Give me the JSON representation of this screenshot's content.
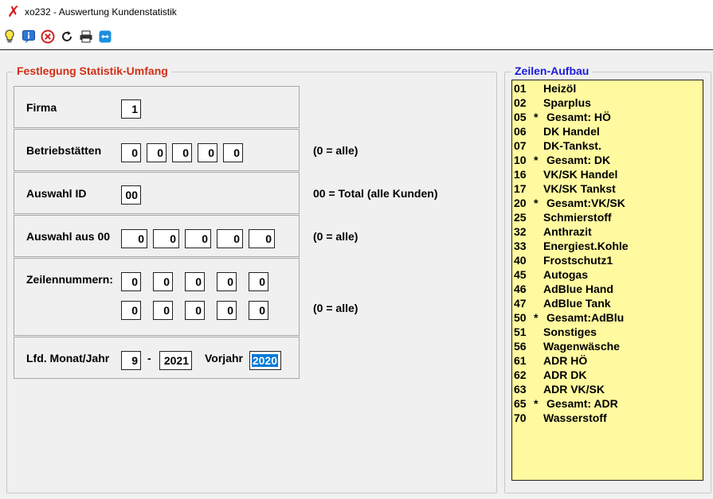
{
  "window": {
    "title": "xo232 - Auswertung Kundenstatistik",
    "icon": "x-icon"
  },
  "toolbar": [
    {
      "name": "lightbulb-icon"
    },
    {
      "name": "info-icon"
    },
    {
      "name": "cancel-icon"
    },
    {
      "name": "refresh-icon"
    },
    {
      "name": "printer-icon"
    },
    {
      "name": "remote-support-icon"
    }
  ],
  "statistik": {
    "legend": "Festlegung Statistik-Umfang",
    "firma": {
      "label": "Firma",
      "value": "1"
    },
    "betriebsstaetten": {
      "label": "Betriebstätten",
      "values": [
        "0",
        "0",
        "0",
        "0",
        "0"
      ],
      "hint": "(0 = alle)"
    },
    "auswahl_id": {
      "label": "Auswahl ID",
      "value": "00",
      "hint": "00 = Total (alle Kunden)"
    },
    "auswahl_aus": {
      "label": "Auswahl aus  00",
      "values": [
        "0",
        "0",
        "0",
        "0",
        "0"
      ],
      "hint": "(0 = alle)"
    },
    "zeilennummern": {
      "label": "Zeilennummern:",
      "row1": [
        "0",
        "0",
        "0",
        "0",
        "0"
      ],
      "row2": [
        "0",
        "0",
        "0",
        "0",
        "0"
      ],
      "hint": "(0 = alle)"
    },
    "monat": {
      "label": "Lfd. Monat/Jahr",
      "month": "9",
      "sep": "-",
      "year": "2021",
      "vorjahr_label": "Vorjahr",
      "vorjahr": "2020"
    }
  },
  "zeilen": {
    "legend": "Zeilen-Aufbau",
    "items": [
      {
        "code": "01",
        "star": "",
        "name": "Heizöl"
      },
      {
        "code": "02",
        "star": "",
        "name": "Sparplus"
      },
      {
        "code": "05",
        "star": "*",
        "name": "Gesamt: HÖ"
      },
      {
        "code": "06",
        "star": "",
        "name": "DK Handel"
      },
      {
        "code": "07",
        "star": "",
        "name": "DK-Tankst."
      },
      {
        "code": "10",
        "star": "*",
        "name": "Gesamt: DK"
      },
      {
        "code": "16",
        "star": "",
        "name": "VK/SK Handel"
      },
      {
        "code": "17",
        "star": "",
        "name": "VK/SK Tankst"
      },
      {
        "code": "20",
        "star": "*",
        "name": "Gesamt:VK/SK"
      },
      {
        "code": "25",
        "star": "",
        "name": "Schmierstoff"
      },
      {
        "code": "32",
        "star": "",
        "name": "Anthrazit"
      },
      {
        "code": "33",
        "star": "",
        "name": "Energiest.Kohle"
      },
      {
        "code": "40",
        "star": "",
        "name": "Frostschutz1"
      },
      {
        "code": "45",
        "star": "",
        "name": "Autogas"
      },
      {
        "code": "46",
        "star": "",
        "name": "AdBlue Hand"
      },
      {
        "code": "47",
        "star": "",
        "name": "AdBlue Tank"
      },
      {
        "code": "50",
        "star": "*",
        "name": "Gesamt:AdBlu"
      },
      {
        "code": "51",
        "star": "",
        "name": "Sonstiges"
      },
      {
        "code": "56",
        "star": "",
        "name": "Wagenwäsche"
      },
      {
        "code": "61",
        "star": "",
        "name": "ADR HÖ"
      },
      {
        "code": "62",
        "star": "",
        "name": "ADR DK"
      },
      {
        "code": "63",
        "star": "",
        "name": "ADR VK/SK"
      },
      {
        "code": "65",
        "star": "*",
        "name": "Gesamt: ADR"
      },
      {
        "code": "70",
        "star": "",
        "name": "Wasserstoff"
      }
    ]
  },
  "colors": {
    "legend_red": "#d22e16",
    "legend_blue": "#1a1adc",
    "list_bg": "#fff9a0",
    "selection": "#0078d7"
  }
}
